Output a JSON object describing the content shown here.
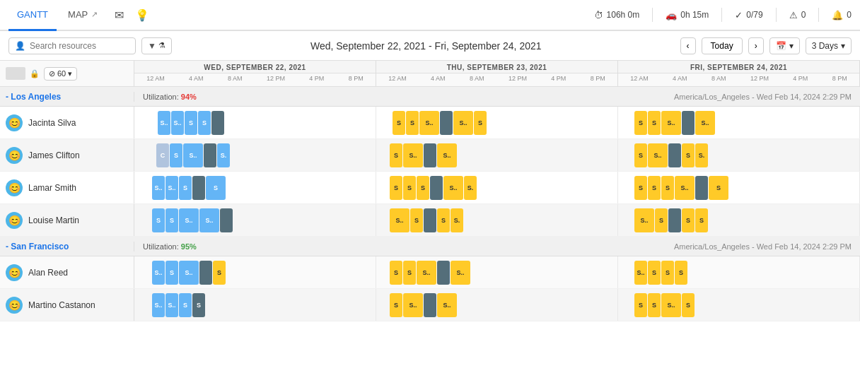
{
  "nav": {
    "tabs": [
      {
        "id": "gantt",
        "label": "GANTT",
        "active": true,
        "icon": null
      },
      {
        "id": "map",
        "label": "MAP",
        "active": false,
        "icon": "↗"
      }
    ],
    "stats": [
      {
        "icon": "⏱",
        "value": "106h 0m",
        "label": "time"
      },
      {
        "icon": "🚗",
        "value": "0h 15m",
        "label": "drive"
      },
      {
        "icon": "✓",
        "value": "0/79",
        "label": "tasks"
      },
      {
        "icon": "⚠",
        "value": "0",
        "label": "alerts"
      },
      {
        "icon": "🔔",
        "value": "0",
        "label": "notifications"
      }
    ]
  },
  "toolbar": {
    "search_placeholder": "Search resources",
    "date_range": "Wed, September 22, 2021 - Fri, September 24, 2021",
    "today_label": "Today",
    "view_label": "3 Days"
  },
  "gantt": {
    "days": [
      {
        "label": "WED, SEPTEMBER 22, 2021",
        "times": [
          "12 AM",
          "4 AM",
          "8 AM",
          "12 PM",
          "4 PM",
          "8 PM"
        ]
      },
      {
        "label": "THU, SEPTEMBER 23, 2021",
        "times": [
          "12 AM",
          "4 AM",
          "8 AM",
          "12 PM",
          "4 PM",
          "8 PM"
        ]
      },
      {
        "label": "FRI, SEPTEMBER 24, 2021",
        "times": [
          "12 AM",
          "4 AM",
          "8 AM",
          "12 PM",
          "4 PM",
          "8 PM"
        ]
      }
    ],
    "groups": [
      {
        "name": "- Los Angeles",
        "utilization": "94%",
        "utilization_class": "high",
        "timezone_label": "America/Los_Angeles - Wed Feb 14, 2024 2:29 PM",
        "resources": [
          {
            "name": "Jacinta Silva",
            "avatar": "😊"
          },
          {
            "name": "James Clifton",
            "avatar": "😊"
          },
          {
            "name": "Lamar Smith",
            "avatar": "😊"
          },
          {
            "name": "Louise Martin",
            "avatar": "😊"
          }
        ]
      },
      {
        "name": "- San Francisco",
        "utilization": "95%",
        "utilization_class": "ok",
        "timezone_label": "America/Los_Angeles - Wed Feb 14, 2024 2:29 PM",
        "resources": [
          {
            "name": "Alan Reed",
            "avatar": "😊"
          },
          {
            "name": "Martino Castanon",
            "avatar": "😊"
          }
        ]
      }
    ]
  },
  "speed": {
    "icon": "⊘",
    "value": "60"
  }
}
